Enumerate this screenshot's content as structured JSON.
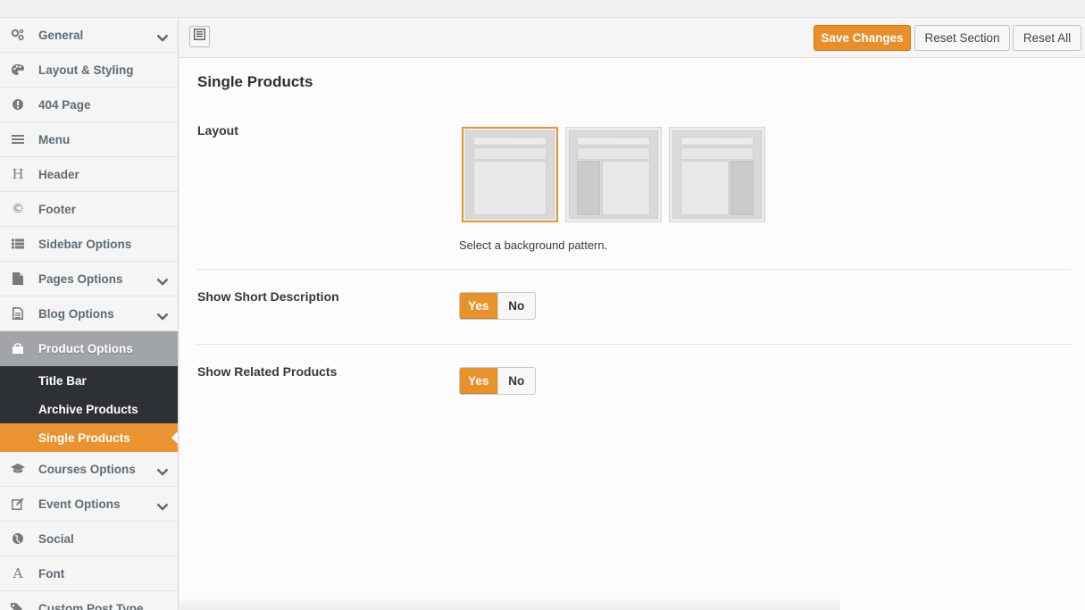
{
  "sidebar": {
    "items": [
      {
        "label": "General",
        "icon": "gears-icon",
        "has_submenu": true
      },
      {
        "label": "Layout & Styling",
        "icon": "palette-icon",
        "has_submenu": false
      },
      {
        "label": "404 Page",
        "icon": "exclamation-circle-icon",
        "has_submenu": false
      },
      {
        "label": "Menu",
        "icon": "bars-icon",
        "has_submenu": false
      },
      {
        "label": "Header",
        "icon": "header-h-icon",
        "has_submenu": false
      },
      {
        "label": "Footer",
        "icon": "copyright-icon",
        "has_submenu": false
      },
      {
        "label": "Sidebar Options",
        "icon": "list-icon",
        "has_submenu": false
      },
      {
        "label": "Pages Options",
        "icon": "file-icon",
        "has_submenu": true
      },
      {
        "label": "Blog Options",
        "icon": "file-text-icon",
        "has_submenu": true
      },
      {
        "label": "Product Options",
        "icon": "shopping-bag-icon",
        "has_submenu": false,
        "active": true
      },
      {
        "label": "Courses Options",
        "icon": "graduation-cap-icon",
        "has_submenu": true
      },
      {
        "label": "Event Options",
        "icon": "edit-icon",
        "has_submenu": true
      },
      {
        "label": "Social",
        "icon": "globe-icon",
        "has_submenu": false
      },
      {
        "label": "Font",
        "icon": "font-icon",
        "has_submenu": false
      },
      {
        "label": "Custom Post Type",
        "icon": "tags-icon",
        "has_submenu": false
      }
    ],
    "subitems": [
      {
        "label": "Title Bar"
      },
      {
        "label": "Archive Products"
      },
      {
        "label": "Single Products",
        "current": true
      }
    ]
  },
  "toolbar": {
    "save_label": "Save Changes",
    "reset_section_label": "Reset Section",
    "reset_all_label": "Reset All"
  },
  "section": {
    "title": "Single Products",
    "layout": {
      "label": "Layout",
      "options": [
        "full-width",
        "left-sidebar",
        "right-sidebar"
      ],
      "selected": "full-width",
      "helper": "Select a background pattern."
    },
    "short_description": {
      "label": "Show Short Description",
      "yes": "Yes",
      "no": "No",
      "value": "Yes"
    },
    "related_products": {
      "label": "Show Related Products",
      "yes": "Yes",
      "no": "No",
      "value": "Yes"
    }
  },
  "colors": {
    "accent": "#ea9330",
    "active_nav": "#a1a5a9",
    "subnav_bg": "#2d3035"
  }
}
